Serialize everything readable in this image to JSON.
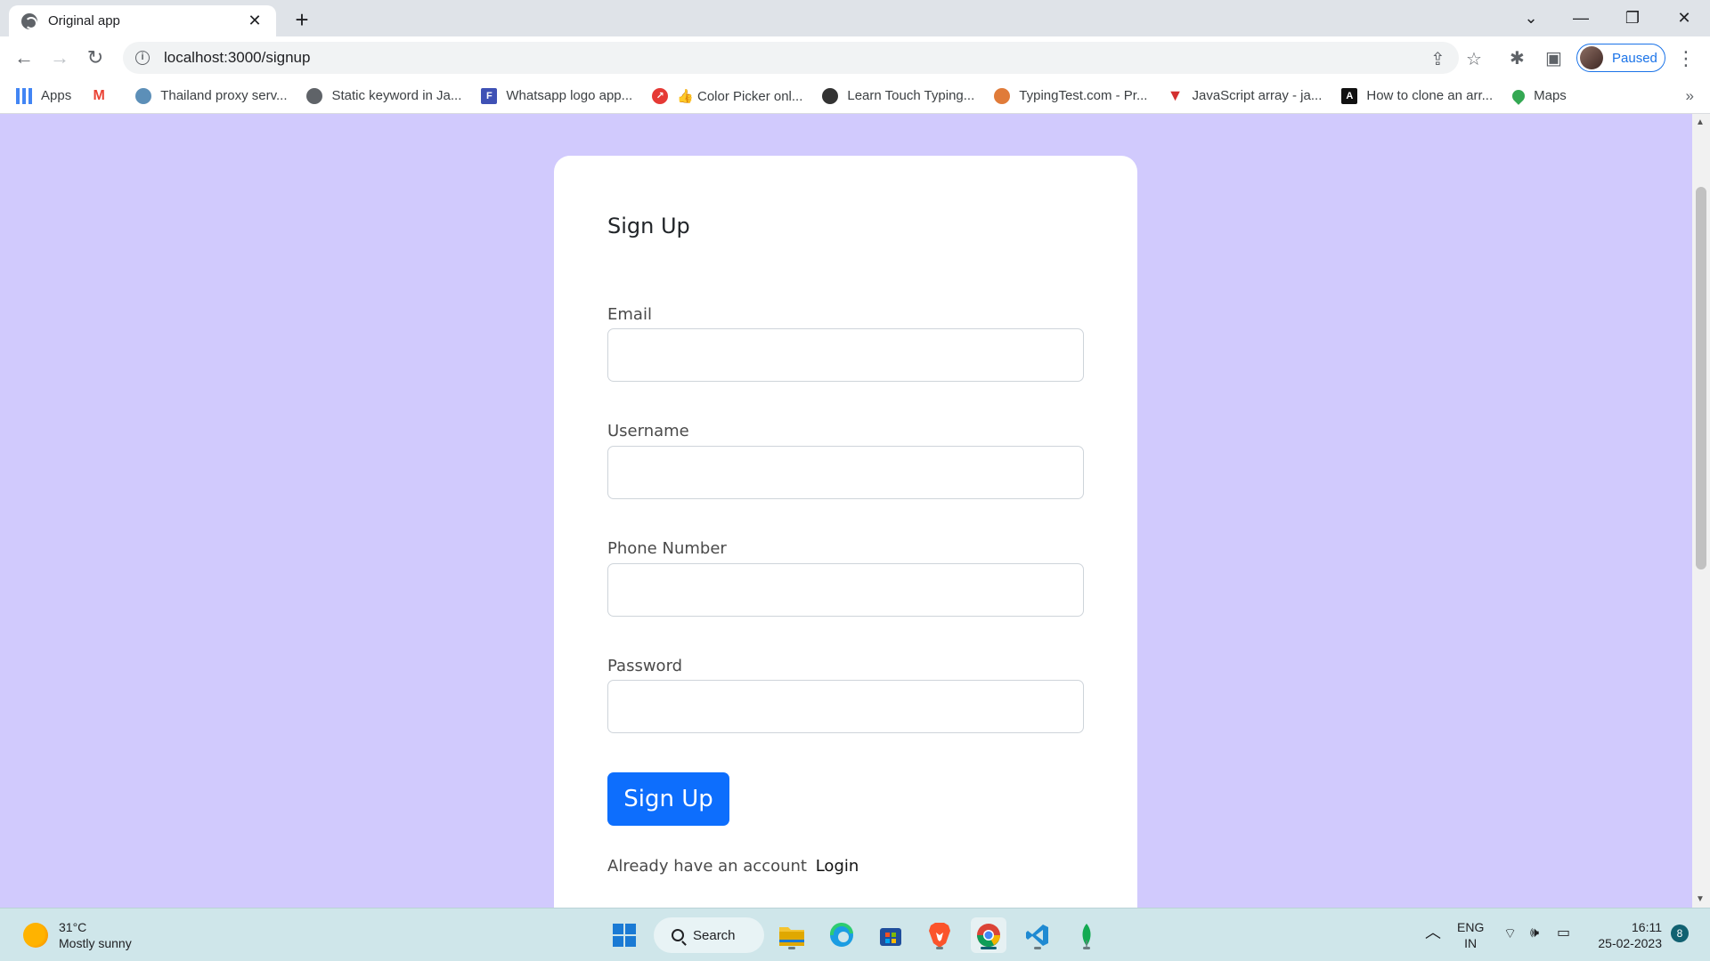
{
  "browser": {
    "tab_title": "Original app",
    "url": "localhost:3000/signup",
    "profile_status": "Paused"
  },
  "bookmarks": [
    {
      "label": "Apps",
      "icon": "apps-grid-icon",
      "color": "#4285f4"
    },
    {
      "label": "",
      "icon": "gmail-icon",
      "color": "#ea4335"
    },
    {
      "label": "Thailand proxy serv...",
      "icon": "globe-avatar-icon",
      "color": "#5c8fb8"
    },
    {
      "label": "Static keyword in Ja...",
      "icon": "globe-icon",
      "color": "#5f6368"
    },
    {
      "label": "Whatsapp logo app...",
      "icon": "formget-icon",
      "color": "#3f51b5"
    },
    {
      "label": "👍 Color Picker onl...",
      "icon": "color-picker-icon",
      "color": "#e53935"
    },
    {
      "label": "Learn Touch Typing...",
      "icon": "typing-ninja-icon",
      "color": "#333333"
    },
    {
      "label": "TypingTest.com - Pr...",
      "icon": "typingtest-icon",
      "color": "#e07b39"
    },
    {
      "label": "JavaScript array - ja...",
      "icon": "javascript-icon",
      "color": "#d32f2f"
    },
    {
      "label": "How to clone an arr...",
      "icon": "clone-icon",
      "color": "#111111"
    },
    {
      "label": "Maps",
      "icon": "maps-pin-icon",
      "color": "#34a853"
    }
  ],
  "form": {
    "title": "Sign Up",
    "email_label": "Email",
    "username_label": "Username",
    "phone_label": "Phone Number",
    "password_label": "Password",
    "email_value": "",
    "username_value": "",
    "phone_value": "",
    "password_value": "",
    "submit_label": "Sign Up",
    "already_text": "Already have an account",
    "login_link": "Login"
  },
  "taskbar": {
    "temperature": "31°C",
    "weather": "Mostly sunny",
    "search_label": "Search",
    "lang_line1": "ENG",
    "lang_line2": "IN",
    "time": "16:11",
    "date": "25-02-2023",
    "notification_count": "8"
  },
  "colors": {
    "page_background": "#d1cafd",
    "primary_button": "#0d6efd",
    "card_background": "#ffffff"
  }
}
